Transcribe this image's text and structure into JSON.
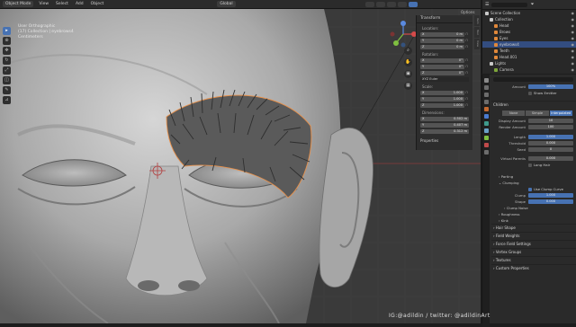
{
  "header": {
    "mode": "Object Mode",
    "menus": [
      "View",
      "Select",
      "Add",
      "Object"
    ],
    "transform_orientation": "Global"
  },
  "viewport": {
    "overlay_lines": [
      "User Orthographic",
      "(17) Collection | eyebrows4",
      "Centimeters"
    ]
  },
  "toolbar": {
    "tools": [
      "select-icon",
      "cursor-icon",
      "move-icon",
      "rotate-icon",
      "scale-icon",
      "transform-icon",
      "annotate-icon",
      "measure-icon"
    ]
  },
  "options_label": "Options",
  "npanel": {
    "title": "Transform",
    "location_label": "Location:",
    "location": [
      [
        "X",
        "0 m"
      ],
      [
        "Y",
        "0 m"
      ],
      [
        "Z",
        "0 m"
      ]
    ],
    "rotation_label": "Rotation:",
    "rotation": [
      [
        "X",
        "0°"
      ],
      [
        "Y",
        "0°"
      ],
      [
        "Z",
        "0°"
      ]
    ],
    "rotation_mode": "XYZ Euler",
    "scale_label": "Scale:",
    "scale": [
      [
        "X",
        "1.000"
      ],
      [
        "Y",
        "1.000"
      ],
      [
        "Z",
        "1.000"
      ]
    ],
    "dimensions_label": "Dimensions:",
    "dimensions": [
      [
        "X",
        "0.502 m"
      ],
      [
        "Y",
        "0.407 m"
      ],
      [
        "Z",
        "0.312 m"
      ]
    ],
    "properties_label": "Properties"
  },
  "sidetabs": [
    "Item",
    "Tool",
    "View"
  ],
  "outliner": {
    "title": "Scene Collection",
    "rows": [
      {
        "name": "Scene Collection",
        "indent": 0,
        "color": "#c9c9c9",
        "selected": false
      },
      {
        "name": "Collection",
        "indent": 1,
        "color": "#c9c9c9",
        "selected": false
      },
      {
        "name": "Head",
        "indent": 2,
        "color": "#e0883a",
        "selected": false
      },
      {
        "name": "Brows",
        "indent": 2,
        "color": "#e0883a",
        "selected": false
      },
      {
        "name": "Eyes",
        "indent": 2,
        "color": "#e0883a",
        "selected": false
      },
      {
        "name": "eyebrows4",
        "indent": 2,
        "color": "#e0883a",
        "selected": true
      },
      {
        "name": "Teeth",
        "indent": 2,
        "color": "#e0883a",
        "selected": false
      },
      {
        "name": "Head.001",
        "indent": 2,
        "color": "#e0883a",
        "selected": false
      },
      {
        "name": "Lights",
        "indent": 1,
        "color": "#c9c9c9",
        "selected": false
      },
      {
        "name": "Camera",
        "indent": 2,
        "color": "#7ea63a",
        "selected": false
      }
    ]
  },
  "properties": {
    "amount_label": "Amount",
    "amount_value": "100%",
    "show_emitter": "Show Emitter",
    "children_title": "Children",
    "children_modes": [
      "None",
      "Simple",
      "Interpolated"
    ],
    "children_active": 2,
    "rows": [
      {
        "label": "Display Amount",
        "value": "10"
      },
      {
        "label": "Render Amount",
        "value": "100"
      }
    ],
    "rows2": [
      {
        "label": "Length",
        "value": "1.000",
        "blue": true
      },
      {
        "label": "Threshold",
        "value": "0.000",
        "blue": false
      },
      {
        "label": "Seed",
        "value": "0",
        "blue": false
      }
    ],
    "virtual_parents": {
      "label": "Virtual Parents",
      "value": "0.000"
    },
    "long_hair": "Long Hair",
    "parting": "Parting",
    "clumping": "Clumping",
    "use_clump_curve": "Use Clump Curve",
    "clump_rows": [
      {
        "label": "Clump",
        "value": "1.000",
        "blue": true
      },
      {
        "label": "Shape",
        "value": "0.000",
        "blue": true
      }
    ],
    "clump_noise": "Clump Noise",
    "roughness": "Roughness",
    "kink": "Kink",
    "sections": [
      "Hair Shape",
      "Field Weights",
      "Force Field Settings",
      "Vertex Groups",
      "Textures",
      "Custom Properties"
    ]
  },
  "watermark": "IG:@adildin / twitter: @adildinArt"
}
